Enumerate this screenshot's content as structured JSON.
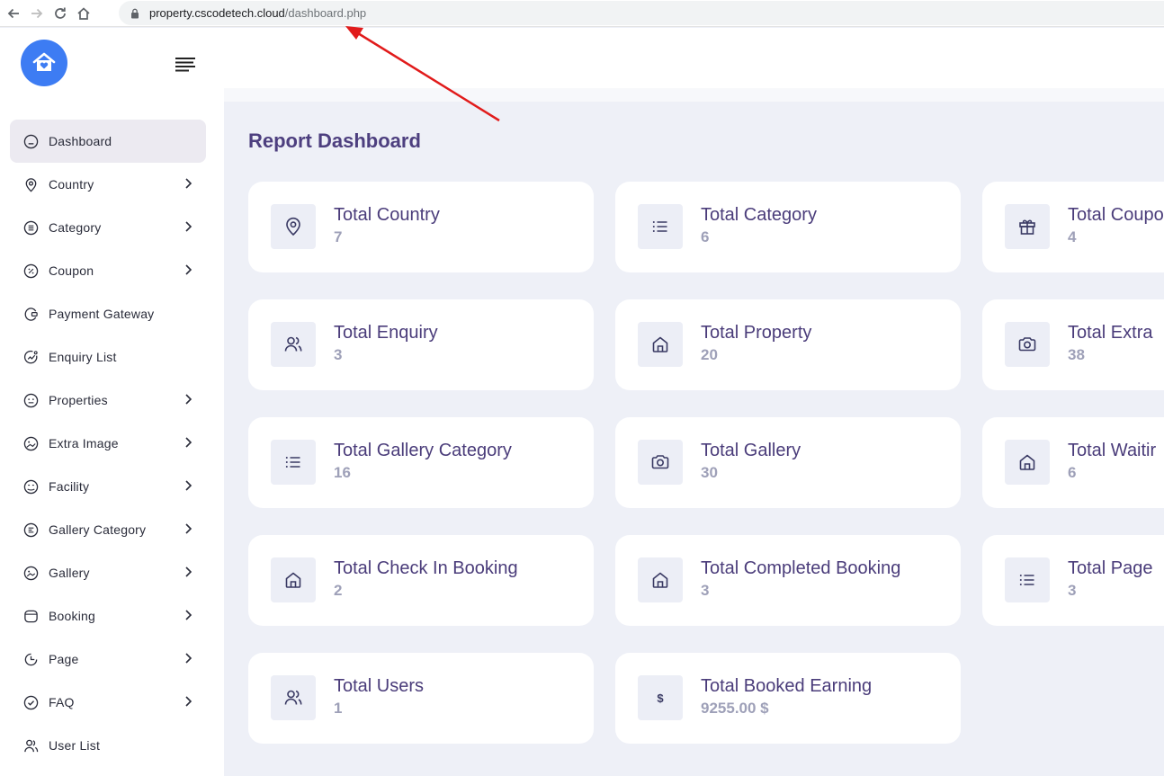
{
  "browser": {
    "url_host": "property.cscodetech.cloud",
    "url_path": "/dashboard.php"
  },
  "sidebar": {
    "items": [
      {
        "label": "Dashboard",
        "icon": "home-icon",
        "has_submenu": false,
        "active": true
      },
      {
        "label": "Country",
        "icon": "map-pin-icon",
        "has_submenu": true
      },
      {
        "label": "Category",
        "icon": "list-circle-icon",
        "has_submenu": true
      },
      {
        "label": "Coupon",
        "icon": "percent-circle-icon",
        "has_submenu": true
      },
      {
        "label": "Payment Gateway",
        "icon": "wallet-icon",
        "has_submenu": false
      },
      {
        "label": "Enquiry List",
        "icon": "chart-circle-icon",
        "has_submenu": false
      },
      {
        "label": "Properties",
        "icon": "smile-circle-icon",
        "has_submenu": true
      },
      {
        "label": "Extra Image",
        "icon": "image-icon",
        "has_submenu": true
      },
      {
        "label": "Facility",
        "icon": "facility-icon",
        "has_submenu": true
      },
      {
        "label": "Gallery Category",
        "icon": "gallery-category-icon",
        "has_submenu": true
      },
      {
        "label": "Gallery",
        "icon": "gallery-icon",
        "has_submenu": true
      },
      {
        "label": "Booking",
        "icon": "booking-icon",
        "has_submenu": true
      },
      {
        "label": "Page",
        "icon": "page-icon",
        "has_submenu": true
      },
      {
        "label": "FAQ",
        "icon": "check-circle-icon",
        "has_submenu": true
      },
      {
        "label": "User List",
        "icon": "user-list-icon",
        "has_submenu": false
      }
    ]
  },
  "main": {
    "title": "Report Dashboard",
    "cards": [
      {
        "label": "Total Country",
        "value": "7",
        "icon": "map-pin-icon"
      },
      {
        "label": "Total Category",
        "value": "6",
        "icon": "list-icon"
      },
      {
        "label": "Total Coupo",
        "value": "4",
        "icon": "gift-icon"
      },
      {
        "label": "Total Enquiry",
        "value": "3",
        "icon": "users-icon"
      },
      {
        "label": "Total Property",
        "value": "20",
        "icon": "home-icon"
      },
      {
        "label": "Total Extra",
        "value": "38",
        "icon": "camera-icon"
      },
      {
        "label": "Total Gallery Category",
        "value": "16",
        "icon": "list-icon"
      },
      {
        "label": "Total Gallery",
        "value": "30",
        "icon": "camera-icon"
      },
      {
        "label": "Total Waitir",
        "value": "6",
        "icon": "home-icon"
      },
      {
        "label": "Total Check In Booking",
        "value": "2",
        "icon": "home-icon"
      },
      {
        "label": "Total Completed Booking",
        "value": "3",
        "icon": "home-icon"
      },
      {
        "label": "Total Page",
        "value": "3",
        "icon": "list-icon"
      },
      {
        "label": "Total Users",
        "value": "1",
        "icon": "users-icon"
      },
      {
        "label": "Total Booked Earning",
        "value": "9255.00 $",
        "icon": "dollar-icon",
        "icon_text": "$"
      }
    ]
  },
  "colors": {
    "accent": "#3d7cf3",
    "title": "#4d3f7f",
    "background": "#eef0f7",
    "annotation_arrow": "#e11b1b"
  }
}
